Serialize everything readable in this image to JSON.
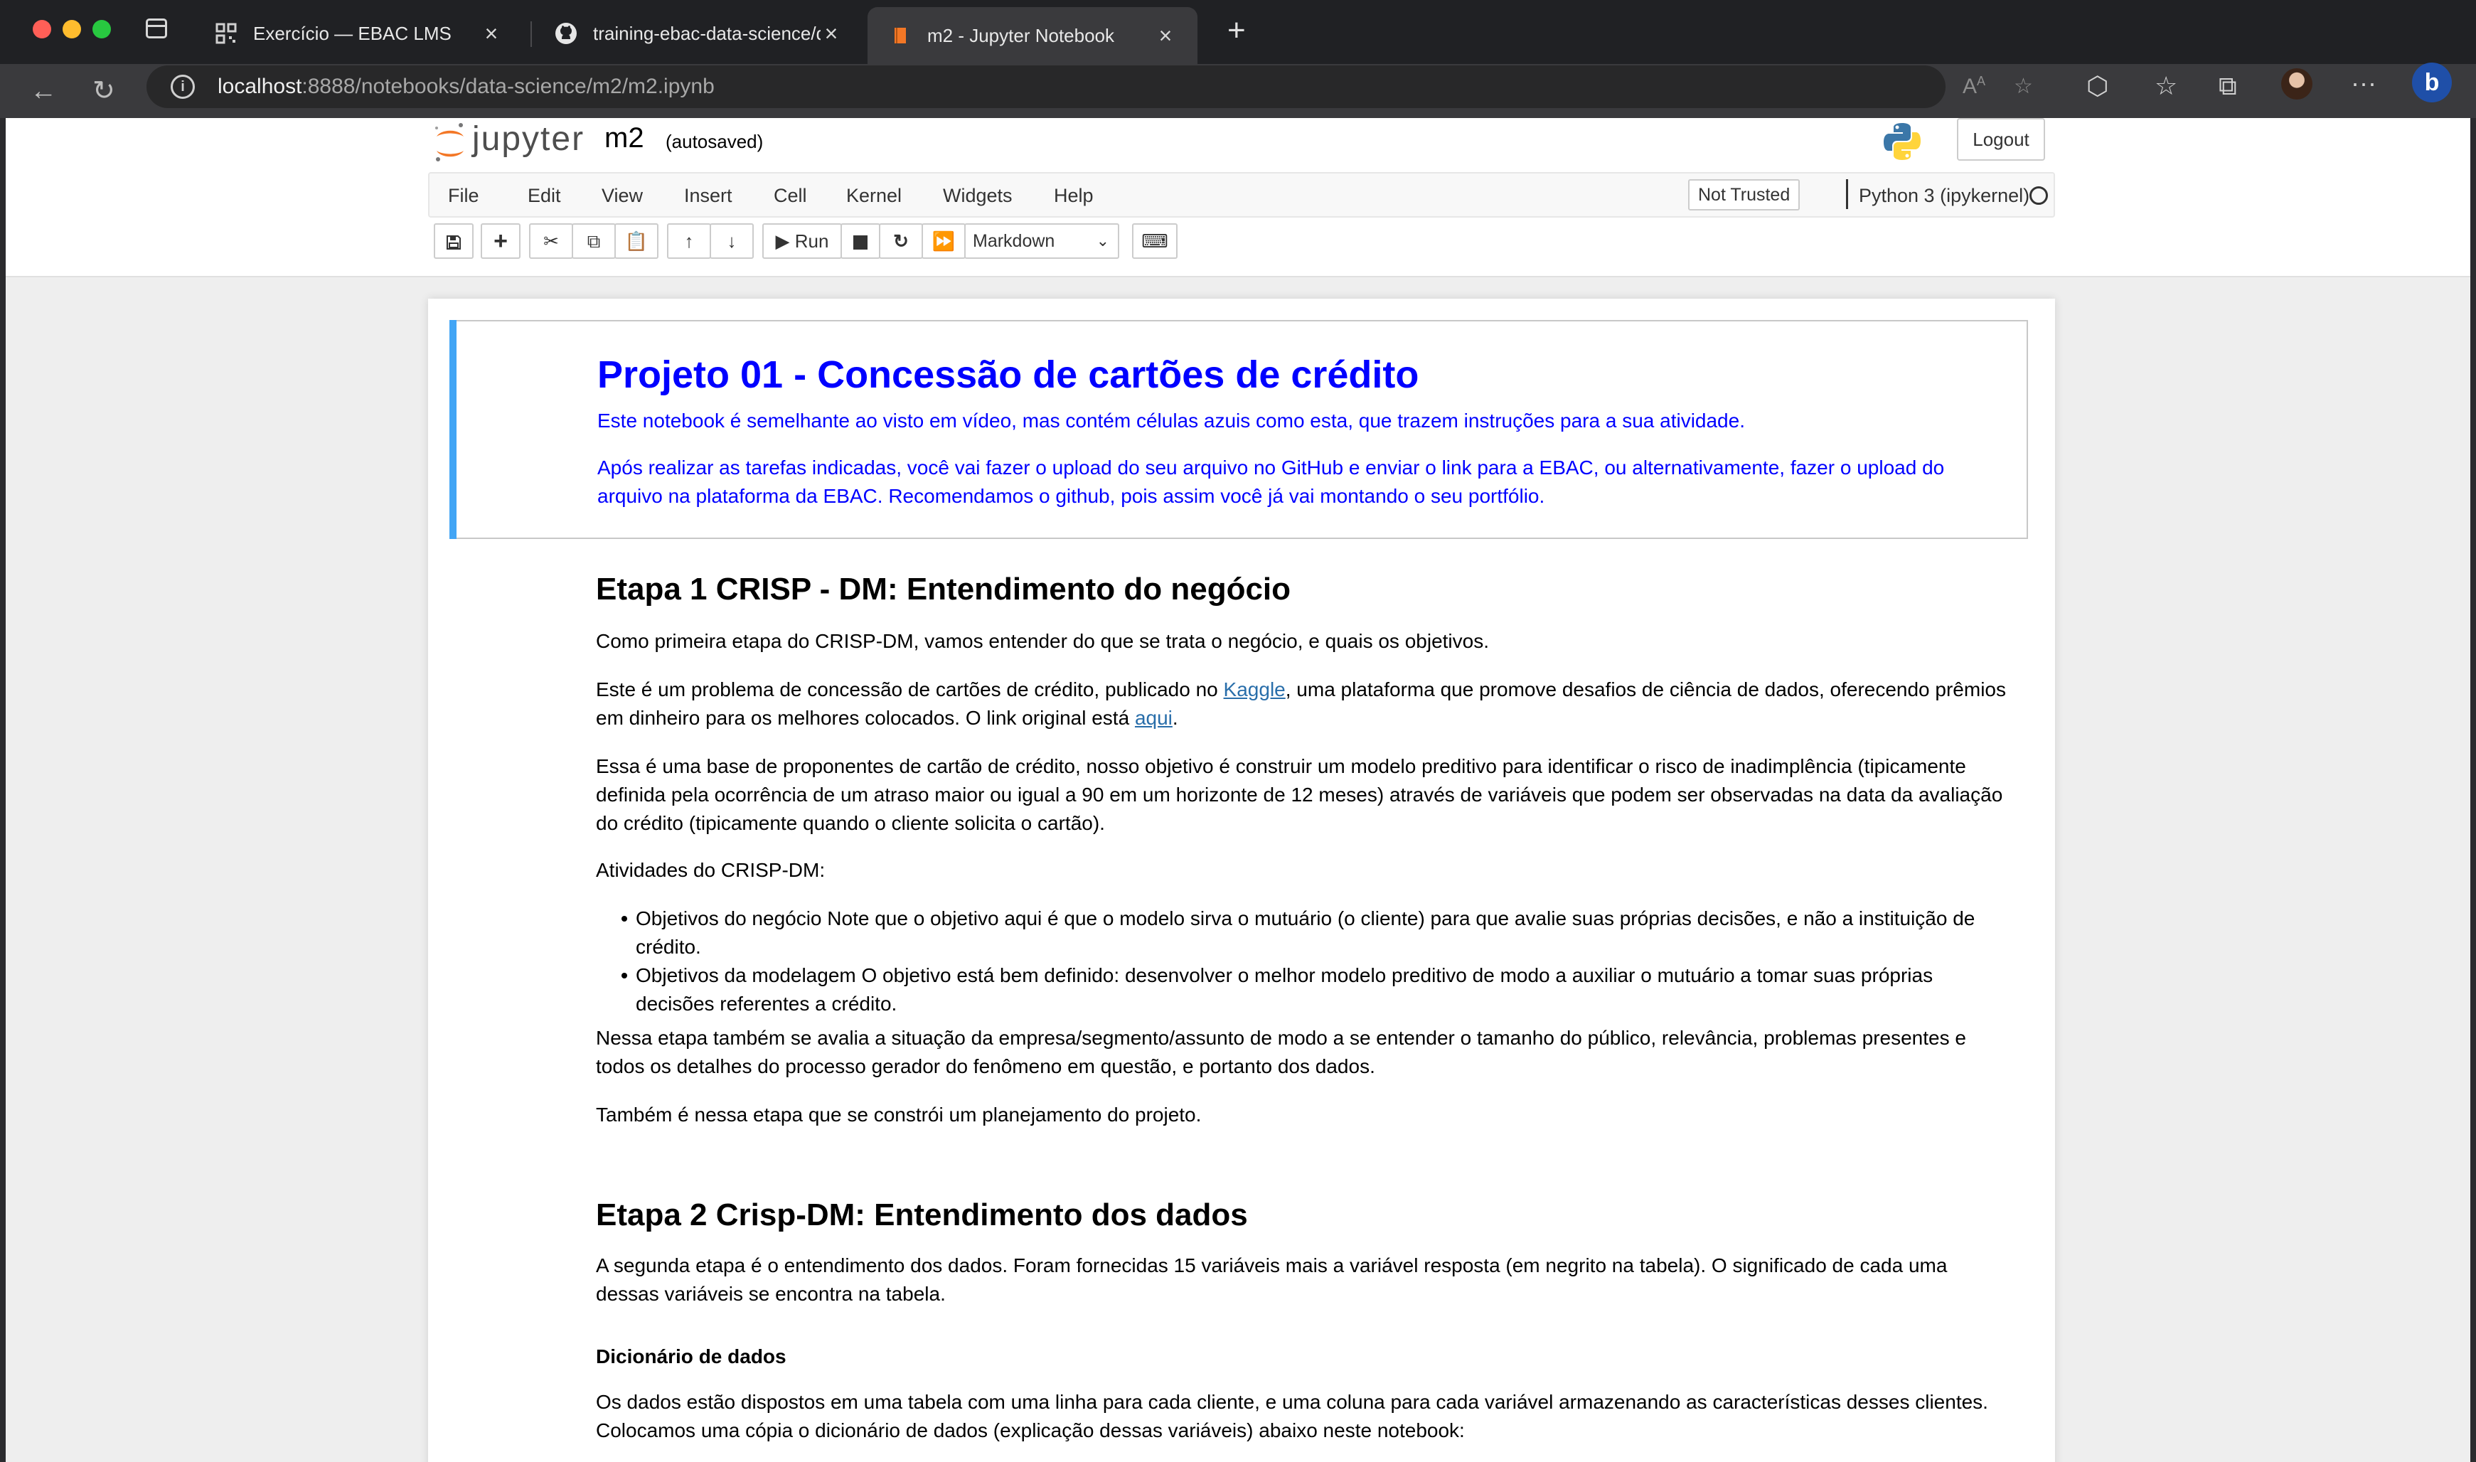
{
  "browser": {
    "tabs": [
      {
        "label": "Exercício — EBAC LMS",
        "icon": "qr-code-icon"
      },
      {
        "label": "training-ebac-data-science/da",
        "icon": "github-icon"
      },
      {
        "label": "m2 - Jupyter Notebook",
        "icon": "jupyter-book-icon",
        "active": true
      }
    ],
    "url_host": "localhost",
    "url_path": ":8888/notebooks/data-science/m2/m2.ipynb"
  },
  "jupyter": {
    "logo_text": "jupyter",
    "notebook_name": "m2",
    "save_status": "(autosaved)",
    "logout_label": "Logout",
    "menu": [
      "File",
      "Edit",
      "View",
      "Insert",
      "Cell",
      "Kernel",
      "Widgets",
      "Help"
    ],
    "trust_label": "Not Trusted",
    "kernel_name": "Python 3 (ipykernel)",
    "run_label": "Run",
    "cell_type": "Markdown"
  },
  "notebook": {
    "intro": {
      "title": "Projeto 01 - Concessão de cartões de crédito",
      "p1": "Este notebook é semelhante ao visto em vídeo, mas contém células azuis como esta, que trazem instruções para a sua atividade.",
      "p2": "Após realizar as tarefas indicadas, você vai fazer o upload do seu arquivo no GitHub e enviar o link para a EBAC, ou alternativamente, fazer o upload do arquivo na plataforma da EBAC. Recomendamos o github, pois assim você já vai montando o seu portfólio."
    },
    "etapa1": {
      "heading": "Etapa 1 CRISP - DM: Entendimento do negócio",
      "p1": "Como primeira etapa do CRISP-DM, vamos entender do que se trata o negócio, e quais os objetivos.",
      "p2_a": "Este é um problema de concessão de cartões de crédito, publicado no ",
      "p2_link1": "Kaggle",
      "p2_b": ", uma plataforma que promove desafios de ciência de dados, oferecendo prêmios em dinheiro para os melhores colocados. O link original está ",
      "p2_link2": "aqui",
      "p2_c": ".",
      "p3": "Essa é uma base de proponentes de cartão de crédito, nosso objetivo é construir um modelo preditivo para identificar o risco de inadimplência (tipicamente definida pela ocorrência de um atraso maior ou igual a 90 em um horizonte de 12 meses) através de variáveis que podem ser observadas na data da avaliação do crédito (tipicamente quando o cliente solicita o cartão).",
      "p4": "Atividades do CRISP-DM:",
      "bullets": [
        "Objetivos do negócio Note que o objetivo aqui é que o modelo sirva o mutuário (o cliente) para que avalie suas próprias decisões, e não a instituição de crédito.",
        "Objetivos da modelagem O objetivo está bem definido: desenvolver o melhor modelo preditivo de modo a auxiliar o mutuário a tomar suas próprias decisões referentes a crédito."
      ],
      "p5": "Nessa etapa também se avalia a situação da empresa/segmento/assunto de modo a se entender o tamanho do público, relevância, problemas presentes e todos os detalhes do processo gerador do fenômeno em questão, e portanto dos dados.",
      "p6": "Também é nessa etapa que se constrói um planejamento do projeto."
    },
    "etapa2": {
      "heading": "Etapa 2 Crisp-DM: Entendimento dos dados",
      "p1": "A segunda etapa é o entendimento dos dados. Foram fornecidas 15 variáveis mais a variável resposta (em negrito na tabela). O significado de cada uma dessas variáveis se encontra na tabela.",
      "subheading": "Dicionário de dados",
      "p2": "Os dados estão dispostos em uma tabela com uma linha para cada cliente, e uma coluna para cada variável armazenando as características desses clientes. Colocamos uma cópia o dicionário de dados (explicação dessas variáveis) abaixo neste notebook:"
    }
  },
  "colors": {
    "chrome_dark": "#202124",
    "instruction_blue": "#0000ff",
    "cell_selected_bar": "#42a5f5",
    "jupyter_orange": "#f37726",
    "link": "#296eaa"
  }
}
